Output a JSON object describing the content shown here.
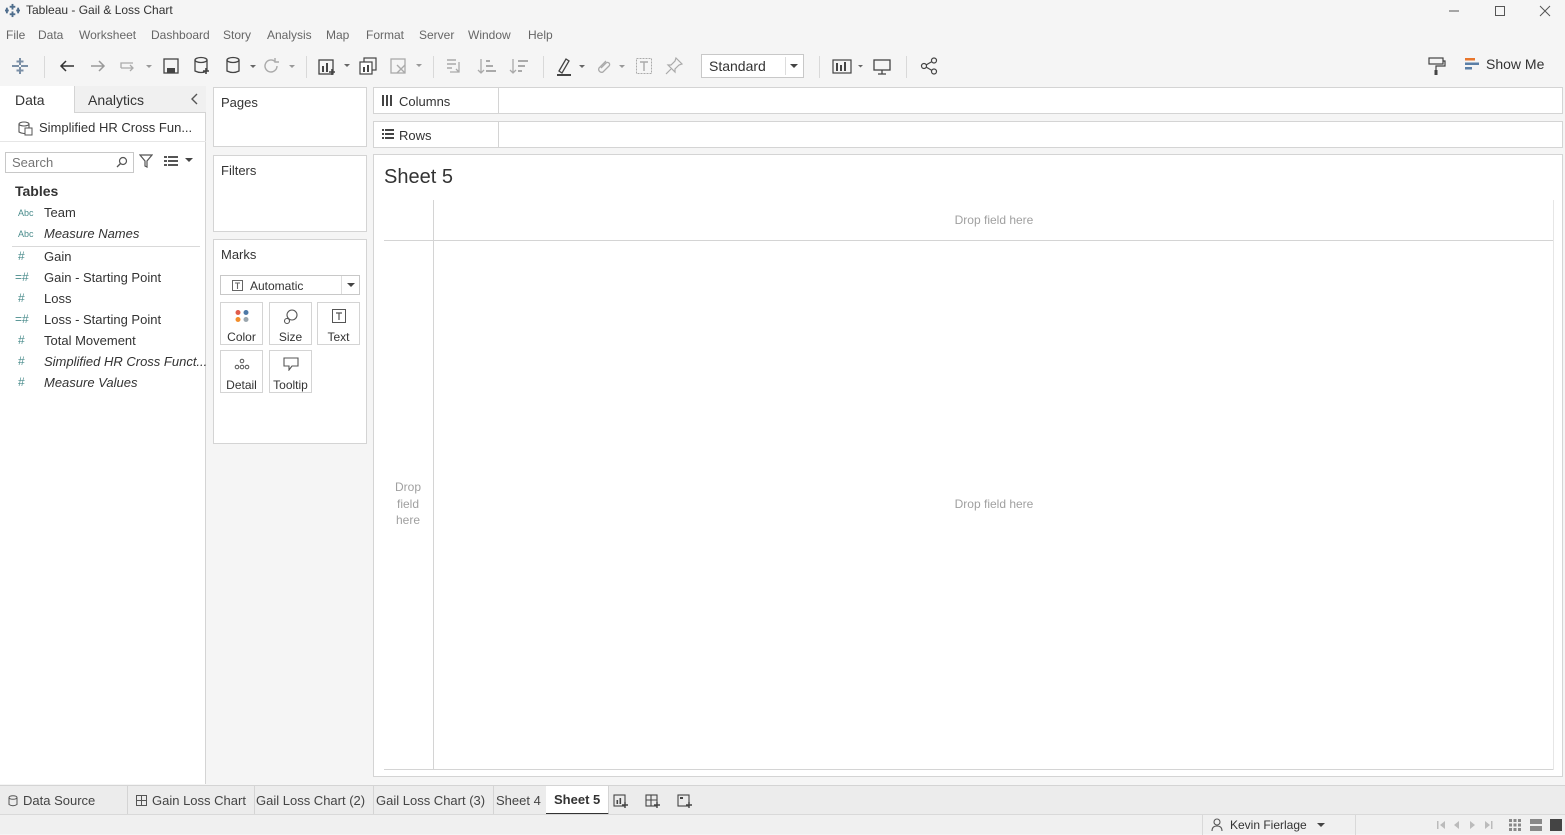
{
  "window": {
    "title": "Tableau - Gail & Loss Chart"
  },
  "menu": [
    "File",
    "Data",
    "Worksheet",
    "Dashboard",
    "Story",
    "Analysis",
    "Map",
    "Format",
    "Server",
    "Window",
    "Help"
  ],
  "toolbar": {
    "fit_select": "Standard",
    "show_me": "Show Me"
  },
  "data_pane": {
    "tab_data": "Data",
    "tab_analytics": "Analytics",
    "datasource_name": "Simplified HR Cross Fun...",
    "search_placeholder": "Search",
    "tables_heading": "Tables",
    "dimensions": [
      {
        "type": "Abc",
        "name": "Team"
      },
      {
        "type": "Abc",
        "name": "Measure Names"
      }
    ],
    "measures": [
      {
        "type": "#",
        "name": "Gain"
      },
      {
        "type": "=#",
        "name": "Gain - Starting Point"
      },
      {
        "type": "#",
        "name": "Loss"
      },
      {
        "type": "=#",
        "name": "Loss - Starting Point"
      },
      {
        "type": "#",
        "name": "Total Movement"
      },
      {
        "type": "#",
        "name": "Simplified HR Cross Funct..."
      },
      {
        "type": "#",
        "name": "Measure Values"
      }
    ]
  },
  "cards": {
    "pages": "Pages",
    "filters": "Filters",
    "marks": "Marks",
    "mark_type": "Automatic",
    "mark_buttons": [
      "Color",
      "Size",
      "Text",
      "Detail",
      "Tooltip"
    ]
  },
  "shelves": {
    "columns": "Columns",
    "rows": "Rows"
  },
  "view": {
    "sheet_title": "Sheet 5",
    "drop_top": "Drop field here",
    "drop_left": "Drop field here",
    "drop_center": "Drop field here"
  },
  "sheet_tabs": {
    "data_source": "Data Source",
    "tabs": [
      "Gain Loss Chart",
      "Gail Loss Chart (2)",
      "Gail Loss Chart (3)",
      "Sheet 4",
      "Sheet 5"
    ],
    "active": "Sheet 5"
  },
  "status": {
    "user": "Kevin Fierlage"
  },
  "colors": {
    "accent": "#4a8c8c",
    "marks_color_icon": [
      "#e05c4b",
      "#4e79a7",
      "#f28e2b",
      "#9aa6ae"
    ]
  }
}
